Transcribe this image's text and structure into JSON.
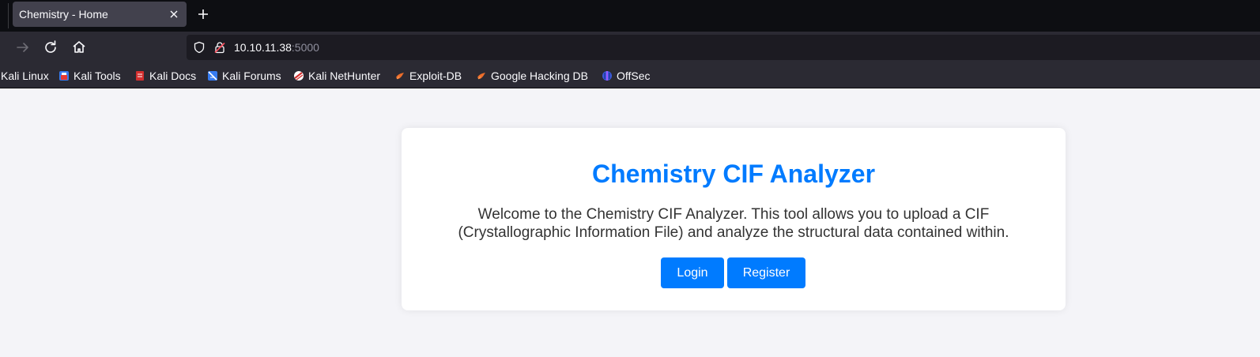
{
  "browser": {
    "tab": {
      "title": "Chemistry - Home"
    },
    "url": {
      "host": "10.10.11.38",
      "port": ":5000"
    },
    "bookmarks": [
      {
        "label": "Kali Linux",
        "icon": "kali-linux-icon"
      },
      {
        "label": "Kali Tools",
        "icon": "kali-tools-icon"
      },
      {
        "label": "Kali Docs",
        "icon": "kali-docs-icon"
      },
      {
        "label": "Kali Forums",
        "icon": "kali-forums-icon"
      },
      {
        "label": "Kali NetHunter",
        "icon": "kali-nethunter-icon"
      },
      {
        "label": "Exploit-DB",
        "icon": "exploit-db-icon"
      },
      {
        "label": "Google Hacking DB",
        "icon": "google-hacking-db-icon"
      },
      {
        "label": "OffSec",
        "icon": "offsec-icon"
      }
    ]
  },
  "page": {
    "title": "Chemistry CIF Analyzer",
    "description": "Welcome to the Chemistry CIF Analyzer. This tool allows you to upload a CIF (Crystallographic Information File) and analyze the structural data contained within.",
    "login_label": "Login",
    "register_label": "Register"
  },
  "colors": {
    "accent": "#007bff",
    "page_background": "#f4f4f8",
    "text": "#333333"
  }
}
